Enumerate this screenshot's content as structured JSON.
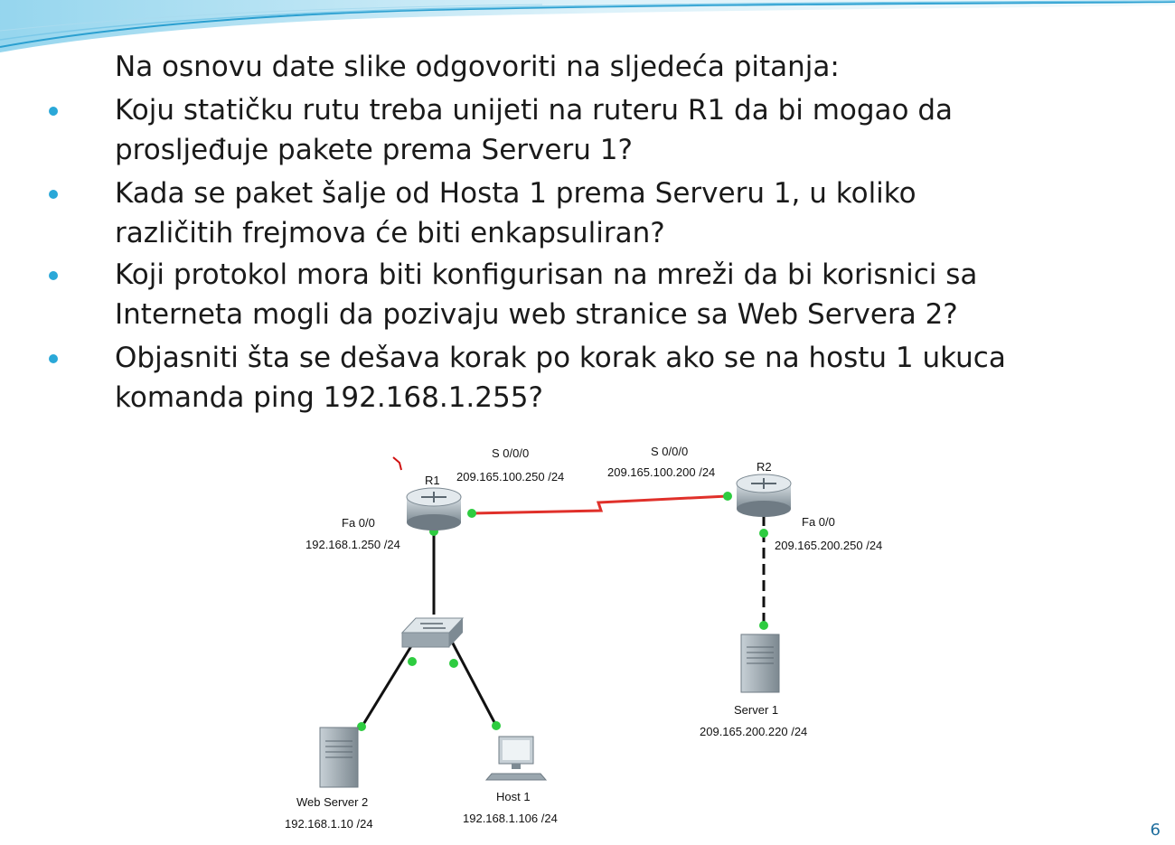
{
  "slide": {
    "intro": "Na osnovu date slike odgovoriti na sljedeća pitanja:",
    "questions": [
      "Koju statičku rutu treba unijeti na ruteru R1 da bi mogao da\nprosljeđuje pakete prema Serveru 1?",
      "Kada se paket šalje od Hosta 1 prema Serveru 1, u koliko\nrazličitih frejmova će biti enkapsuliran?",
      "Koji protokol mora biti konfigurisan na mreži da bi korisnici sa\nInterneta mogli da pozivaju web stranice sa Web Servera 2?",
      "Objasniti šta se dešava korak po korak ako se na hostu 1 ukuca\nkomanda ping 192.168.1.255?"
    ],
    "page_number": "6"
  },
  "diagram": {
    "r1": {
      "name": "R1",
      "serial_iface": "S 0/0/0",
      "serial_ip": "209.165.100.250 /24",
      "fa_iface": "Fa 0/0",
      "fa_ip": "192.168.1.250 /24"
    },
    "r2": {
      "name": "R2",
      "serial_iface": "S 0/0/0",
      "serial_ip": "209.165.100.200 /24",
      "fa_iface": "Fa 0/0",
      "fa_ip": "209.165.200.250 /24"
    },
    "server1": {
      "name": "Server 1",
      "ip": "209.165.200.220 /24"
    },
    "webserver2": {
      "name": "Web Server 2",
      "ip": "192.168.1.10 /24"
    },
    "host1": {
      "name": "Host 1",
      "ip": "192.168.1.106 /24"
    },
    "colors": {
      "serial_link": "#e0302a",
      "link": "#111111",
      "port": "#2ecc40",
      "device": "#9aa6ae"
    }
  }
}
